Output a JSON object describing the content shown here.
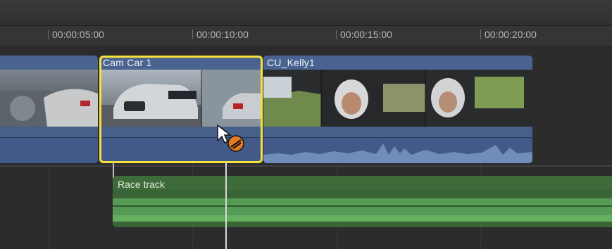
{
  "timeline": {
    "ruler_ticks": [
      "00:00:05:00",
      "00:00:10:00",
      "00:00:15:00",
      "00:00:20:00"
    ]
  },
  "clips": {
    "previous_clip_title": "",
    "selected_clip_title": "Cam Car 1",
    "next_clip_title": "CU_Kelly1",
    "music_clip_title": "Race track"
  },
  "colors": {
    "selection": "#f5e23a",
    "video_clip": "#47608a",
    "audio_clip": "#3d6b3a"
  },
  "icons": {
    "cursor": "arrow-pointer-icon",
    "badge": "retime-blade-icon"
  }
}
